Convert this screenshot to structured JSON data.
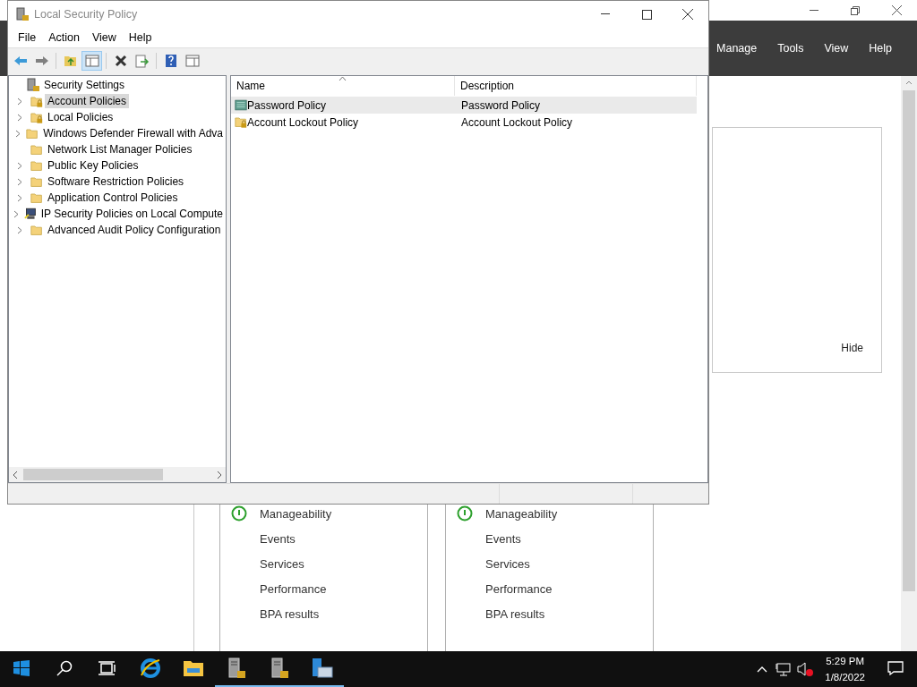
{
  "server_manager": {
    "menu": [
      "Manage",
      "Tools",
      "View",
      "Help"
    ],
    "hide_link": "Hide",
    "tiles": [
      {
        "healthy": true,
        "items": [
          "Manageability",
          "Events",
          "Services",
          "Performance",
          "BPA results"
        ]
      },
      {
        "healthy": true,
        "items": [
          "Manageability",
          "Events",
          "Services",
          "Performance",
          "BPA results"
        ]
      }
    ]
  },
  "window": {
    "title": "Local Security Policy",
    "menu": [
      "File",
      "Action",
      "View",
      "Help"
    ],
    "toolbar": [
      {
        "kind": "back",
        "pressed": false
      },
      {
        "kind": "forward",
        "pressed": false
      },
      {
        "kind": "up",
        "pressed": false
      },
      {
        "kind": "tree",
        "pressed": true
      },
      {
        "kind": "delete",
        "pressed": false
      },
      {
        "kind": "export",
        "pressed": false
      },
      {
        "kind": "help",
        "pressed": false
      },
      {
        "kind": "view",
        "pressed": false
      }
    ],
    "tree": {
      "label": "Security Settings",
      "children": [
        {
          "label": "Account Policies",
          "kind": "locked-folder",
          "expandable": true,
          "selected": true
        },
        {
          "label": "Local Policies",
          "kind": "locked-folder",
          "expandable": true,
          "selected": false
        },
        {
          "label": "Windows Defender Firewall with Adva",
          "kind": "folder",
          "expandable": true,
          "selected": false
        },
        {
          "label": "Network List Manager Policies",
          "kind": "folder",
          "expandable": false,
          "selected": false
        },
        {
          "label": "Public Key Policies",
          "kind": "folder",
          "expandable": true,
          "selected": false
        },
        {
          "label": "Software Restriction Policies",
          "kind": "folder",
          "expandable": true,
          "selected": false
        },
        {
          "label": "Application Control Policies",
          "kind": "folder",
          "expandable": true,
          "selected": false
        },
        {
          "label": "IP Security Policies on Local Compute",
          "kind": "computer",
          "expandable": true,
          "selected": false
        },
        {
          "label": "Advanced Audit Policy Configuration",
          "kind": "folder",
          "expandable": true,
          "selected": false
        }
      ]
    },
    "list": {
      "columns": [
        "Name",
        "Description"
      ],
      "rows": [
        {
          "name": "Password Policy",
          "description": "Password Policy",
          "kind": "policy",
          "selected": true
        },
        {
          "name": "Account Lockout Policy",
          "description": "Account Lockout Policy",
          "kind": "locked-folder",
          "selected": false
        }
      ]
    }
  },
  "taskbar": {
    "apps": [
      {
        "kind": "browser",
        "running": false
      },
      {
        "kind": "explorer",
        "running": false
      },
      {
        "kind": "server",
        "running": true
      },
      {
        "kind": "server",
        "running": true
      },
      {
        "kind": "console",
        "running": true
      }
    ],
    "time": "5:29 PM",
    "date": "1/8/2022"
  }
}
